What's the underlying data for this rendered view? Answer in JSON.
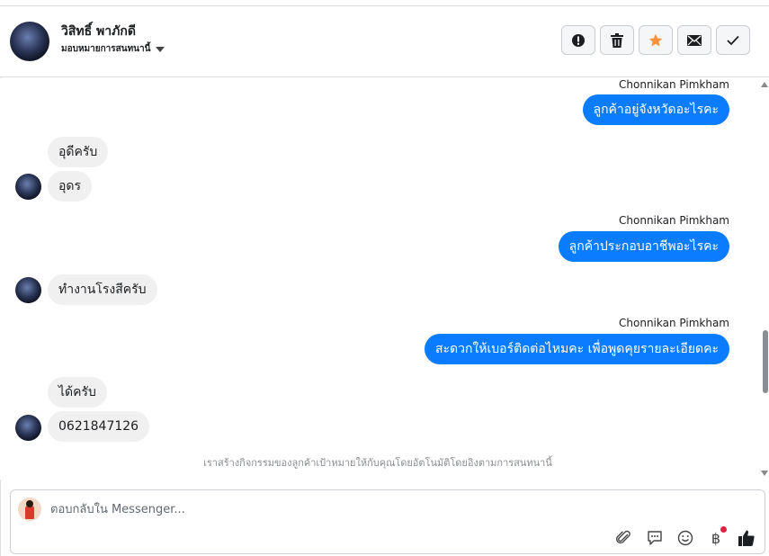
{
  "header": {
    "contact_name": "วิสิทธิ์ พาภักดี",
    "assign_label": "มอบหมายการสนทนานี้",
    "actions": [
      {
        "name": "report-spam",
        "icon": "alert-icon"
      },
      {
        "name": "delete",
        "icon": "trash-icon"
      },
      {
        "name": "star",
        "icon": "star-icon",
        "color": "#f7923b"
      },
      {
        "name": "mark-unread",
        "icon": "envelope-icon"
      },
      {
        "name": "mark-done",
        "icon": "check-icon"
      }
    ]
  },
  "conversation": {
    "messages": [
      {
        "from": "page",
        "sender": "Chonnikan Pimkham",
        "text": "ลูกค้าอยู่จังหวัดอะไรคะ"
      },
      {
        "from": "customer",
        "text": "อุดีครับ"
      },
      {
        "from": "customer",
        "text": "อุดร"
      },
      {
        "from": "page",
        "sender": "Chonnikan Pimkham",
        "text": "ลูกค้าประกอบอาชีพอะไรคะ"
      },
      {
        "from": "customer",
        "text": "ทำงานโรงสีครับ"
      },
      {
        "from": "page",
        "sender": "Chonnikan Pimkham",
        "text": "สะดวกให้เบอร์ติดต่อไหมคะ เพื่อพูดคุยรายละเอียดคะ"
      },
      {
        "from": "customer",
        "text": "ได้ครับ"
      },
      {
        "from": "customer",
        "text": "0621847126"
      }
    ],
    "system_notice": "เราสร้างกิจกรรมของลูกค้าเป้าหมายให้กับคุณโดยอัตโนมัติโดยอิงตามการสนทนานี้"
  },
  "composer": {
    "placeholder": "ตอบกลับใน Messenger...",
    "tools": [
      "paperclip-icon",
      "saved-reply-icon",
      "emoji-icon",
      "baht-payment-icon",
      "thumbs-up-icon"
    ],
    "baht_symbol": "฿"
  },
  "colors": {
    "outgoing_bubble": "#0a7cff",
    "incoming_bubble": "#f0f0f0",
    "notification_dot": "#e41e3f"
  }
}
